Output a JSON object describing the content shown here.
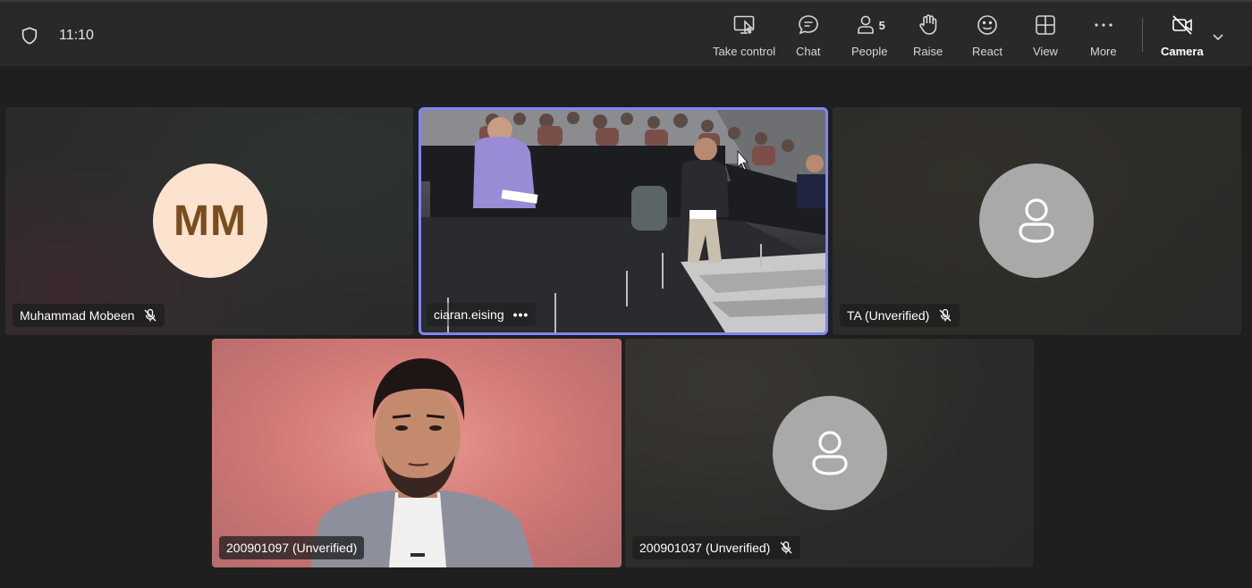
{
  "topbar": {
    "clock": "11:10",
    "buttons": {
      "take_control": "Take control",
      "chat": "Chat",
      "people": "People",
      "people_count": "5",
      "raise": "Raise",
      "react": "React",
      "view": "View",
      "more": "More",
      "camera": "Camera"
    }
  },
  "participants": {
    "muhammad": {
      "initials": "MM",
      "name": "Muhammad Mobeen",
      "muted": true
    },
    "ciaran": {
      "name": "ciaran.eising",
      "more": "•••"
    },
    "ta": {
      "name": "TA (Unverified)",
      "muted": true
    },
    "student1": {
      "name": "200901097 (Unverified)"
    },
    "student2": {
      "name": "200901037 (Unverified)",
      "muted": true
    }
  },
  "colors": {
    "active_speaker_border": "#7f85f5",
    "mm_avatar_bg": "#fbe3cf",
    "mm_avatar_text": "#7a4d1e",
    "generic_avatar_bg": "#a9a9a9"
  }
}
